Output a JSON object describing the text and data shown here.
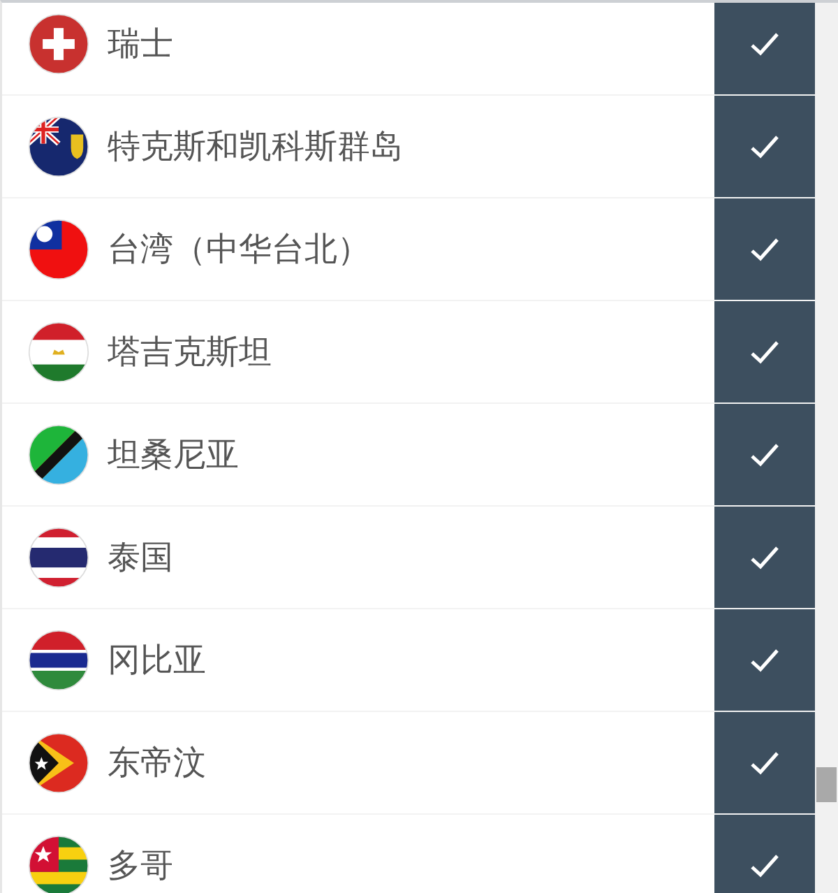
{
  "countries": [
    {
      "name": "瑞士",
      "kind": "switzerland",
      "checked": true
    },
    {
      "name": "特克斯和凯科斯群岛",
      "kind": "turks",
      "checked": true
    },
    {
      "name": "台湾（中华台北）",
      "kind": "taiwan",
      "checked": true
    },
    {
      "name": "塔吉克斯坦",
      "kind": "tajikistan",
      "checked": true
    },
    {
      "name": "坦桑尼亚",
      "kind": "tanzania",
      "checked": true
    },
    {
      "name": "泰国",
      "kind": "thailand",
      "checked": true
    },
    {
      "name": "冈比亚",
      "kind": "gambia",
      "checked": true
    },
    {
      "name": "东帝汶",
      "kind": "timor",
      "checked": true
    },
    {
      "name": "多哥",
      "kind": "togo",
      "checked": true
    }
  ]
}
